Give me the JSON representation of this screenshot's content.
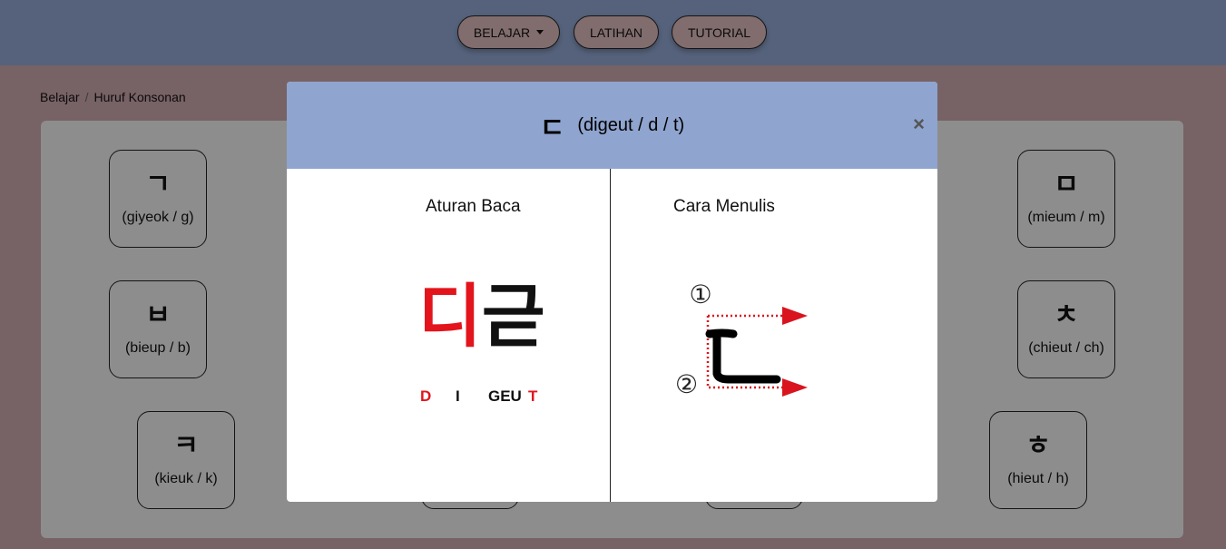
{
  "nav": {
    "belajar": "BELAJAR",
    "latihan": "LATIHAN",
    "tutorial": "TUTORIAL"
  },
  "breadcrumb": {
    "home": "Belajar",
    "current": "Huruf Konsonan"
  },
  "cards": [
    {
      "glyph": "ㄱ",
      "rom": "(giyeok / g)"
    },
    {
      "glyph": "ㅁ",
      "rom": "(mieum / m)"
    },
    {
      "glyph": "ㅂ",
      "rom": "(bieup / b)"
    },
    {
      "glyph": "ㅊ",
      "rom": "(chieut / ch)"
    },
    {
      "glyph": "ㅋ",
      "rom": "(kieuk / k)"
    },
    {
      "glyph": "ㅎ",
      "rom": "(hieut / h)"
    }
  ],
  "modal": {
    "glyph": "ㄷ",
    "title": "(digeut / d / t)",
    "close": "×",
    "left_title": "Aturan Baca",
    "right_title": "Cara Menulis",
    "syllable_1": "디",
    "syllable_2": "귿",
    "pron_d": "D",
    "pron_i": "I",
    "pron_geu": "GEU",
    "pron_t": "T",
    "stroke_1": "①",
    "stroke_2": "②",
    "stroke_glyph": "ㄷ"
  },
  "colors": {
    "header": "#8fa4ce",
    "accent_red": "#e3141c",
    "arrow_red": "#d9141e"
  }
}
